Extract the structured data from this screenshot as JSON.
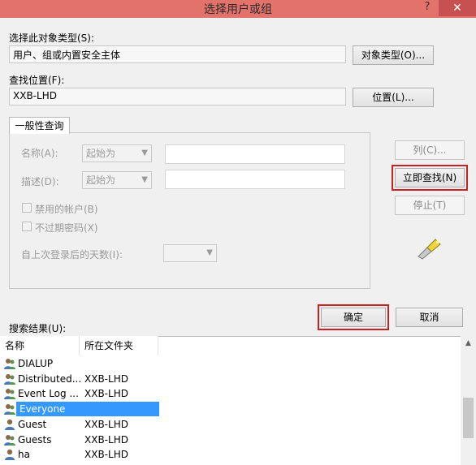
{
  "window": {
    "title": "选择用户或组",
    "help": "?",
    "close": "✕"
  },
  "object_type": {
    "label": "选择此对象类型(S):",
    "value": "用户、组或内置安全主体",
    "button": "对象类型(O)..."
  },
  "location": {
    "label": "查找位置(F):",
    "value": "XXB-LHD",
    "button": "位置(L)..."
  },
  "query": {
    "tab": "一般性查询",
    "name_label": "名称(A):",
    "name_mode": "起始为",
    "desc_label": "描述(D):",
    "desc_mode": "起始为",
    "disabled_accounts": "禁用的帐户(B)",
    "nonexpiring_pwd": "不过期密码(X)",
    "days_since_logon": "自上次登录后的天数(I):"
  },
  "side_buttons": {
    "columns": "列(C)...",
    "find_now": "立即查找(N)",
    "stop": "停止(T)"
  },
  "dialog_buttons": {
    "ok": "确定",
    "cancel": "取消"
  },
  "results": {
    "label": "搜索结果(U):",
    "columns": [
      "名称",
      "所在文件夹"
    ],
    "rows": [
      {
        "name": "DIALUP",
        "folder": "",
        "icon": "group-icon"
      },
      {
        "name": "Distributed...",
        "folder": "XXB-LHD",
        "icon": "group-icon"
      },
      {
        "name": "Event Log ...",
        "folder": "XXB-LHD",
        "icon": "group-icon"
      },
      {
        "name": "Everyone",
        "folder": "",
        "icon": "group-icon",
        "selected": true
      },
      {
        "name": "Guest",
        "folder": "XXB-LHD",
        "icon": "user-icon"
      },
      {
        "name": "Guests",
        "folder": "XXB-LHD",
        "icon": "group-icon"
      },
      {
        "name": "ha",
        "folder": "XXB-LHD",
        "icon": "user-icon"
      }
    ]
  }
}
